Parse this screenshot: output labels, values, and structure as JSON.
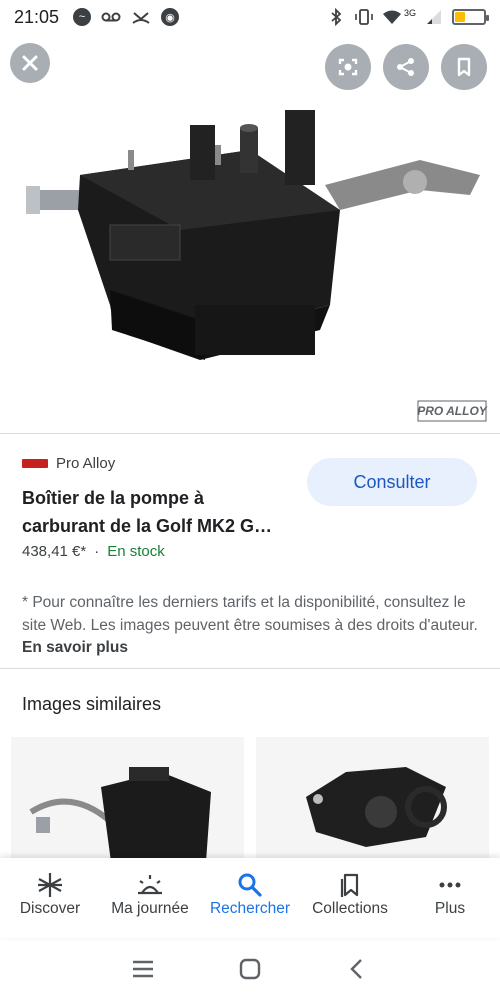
{
  "status_bar": {
    "time": "21:05",
    "network": "3G"
  },
  "product": {
    "watermark": "PRO ALLOY",
    "source": "Pro Alloy",
    "title": "Boîtier de la pompe à carburant de la Golf MK2 G…",
    "price": "438,41 €*",
    "separator": "·",
    "stock": "En stock",
    "consult_label": "Consulter",
    "disclaimer_text": "* Pour connaître les derniers tarifs et la disponibilité, consultez le site Web. Les images peuvent être soumises à des droits d'auteur.",
    "learn_more": "En savoir plus"
  },
  "similar": {
    "heading": "Images similaires"
  },
  "bottom_nav": [
    {
      "label": "Discover",
      "icon": "asterisk-icon"
    },
    {
      "label": "Ma journée",
      "icon": "sunrise-icon"
    },
    {
      "label": "Rechercher",
      "icon": "search-icon"
    },
    {
      "label": "Collections",
      "icon": "bookmark-icon"
    },
    {
      "label": "Plus",
      "icon": "more-dots-icon"
    }
  ],
  "colors": {
    "accent": "#1a73e8",
    "stock_green": "#188038",
    "consult_bg": "#e8f0fe"
  }
}
